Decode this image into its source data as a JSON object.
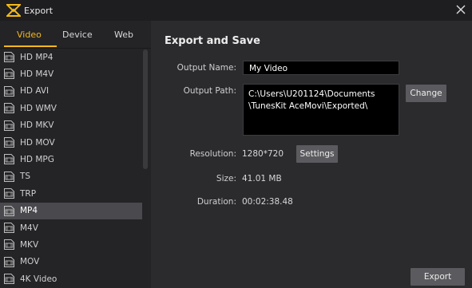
{
  "window": {
    "title": "Export",
    "brand_color": "#f3b81b"
  },
  "tabs": [
    {
      "label": "Video",
      "active": true
    },
    {
      "label": "Device",
      "active": false
    },
    {
      "label": "Web",
      "active": false
    }
  ],
  "formats": [
    {
      "label": "HD MP4",
      "selected": false
    },
    {
      "label": "HD M4V",
      "selected": false
    },
    {
      "label": "HD AVI",
      "selected": false
    },
    {
      "label": "HD WMV",
      "selected": false
    },
    {
      "label": "HD MKV",
      "selected": false
    },
    {
      "label": "HD MOV",
      "selected": false
    },
    {
      "label": "HD MPG",
      "selected": false
    },
    {
      "label": "TS",
      "selected": false
    },
    {
      "label": "TRP",
      "selected": false
    },
    {
      "label": "MP4",
      "selected": true
    },
    {
      "label": "M4V",
      "selected": false
    },
    {
      "label": "MKV",
      "selected": false
    },
    {
      "label": "MOV",
      "selected": false
    },
    {
      "label": "4K Video",
      "selected": false
    }
  ],
  "export": {
    "heading": "Export and Save",
    "output_name_label": "Output Name:",
    "output_name_value": "My Video",
    "output_path_label": "Output Path:",
    "output_path_line1": "C:\\Users\\U201124\\Documents",
    "output_path_line2": "\\TunesKit AceMovi\\Exported\\",
    "change_button": "Change",
    "resolution_label": "Resolution:",
    "resolution_value": "1280*720",
    "settings_button": "Settings",
    "size_label": "Size:",
    "size_value": "41.01 MB",
    "duration_label": "Duration:",
    "duration_value": "00:02:38.48",
    "export_button": "Export"
  }
}
